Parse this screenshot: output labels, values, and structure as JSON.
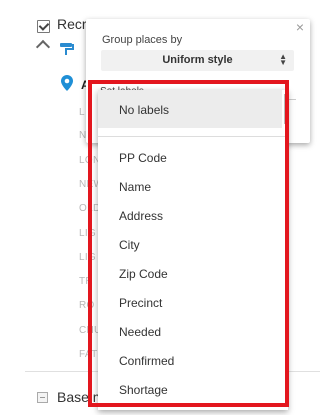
{
  "layer": {
    "title": "Recr",
    "row_a_label": "A"
  },
  "background_items": [
    "L",
    "N",
    "LON",
    "NEW",
    "OLD",
    "LIG",
    "LIG",
    "TR",
    "RO",
    "CHU",
    "FAT"
  ],
  "base_layer": {
    "label": "Base m"
  },
  "group_popup": {
    "close": "×",
    "group_label": "Group places by",
    "group_value": "Uniform style",
    "labels_label": "Set labels"
  },
  "label_options": {
    "selected": "No labels",
    "items": [
      "PP Code",
      "Name",
      "Address",
      "City",
      "Zip Code",
      "Precinct",
      "Needed",
      "Confirmed",
      "Shortage"
    ]
  },
  "colors": {
    "highlight": "#e3161e",
    "pin": "#1f8fd6",
    "accent": "#2a8bd0"
  }
}
